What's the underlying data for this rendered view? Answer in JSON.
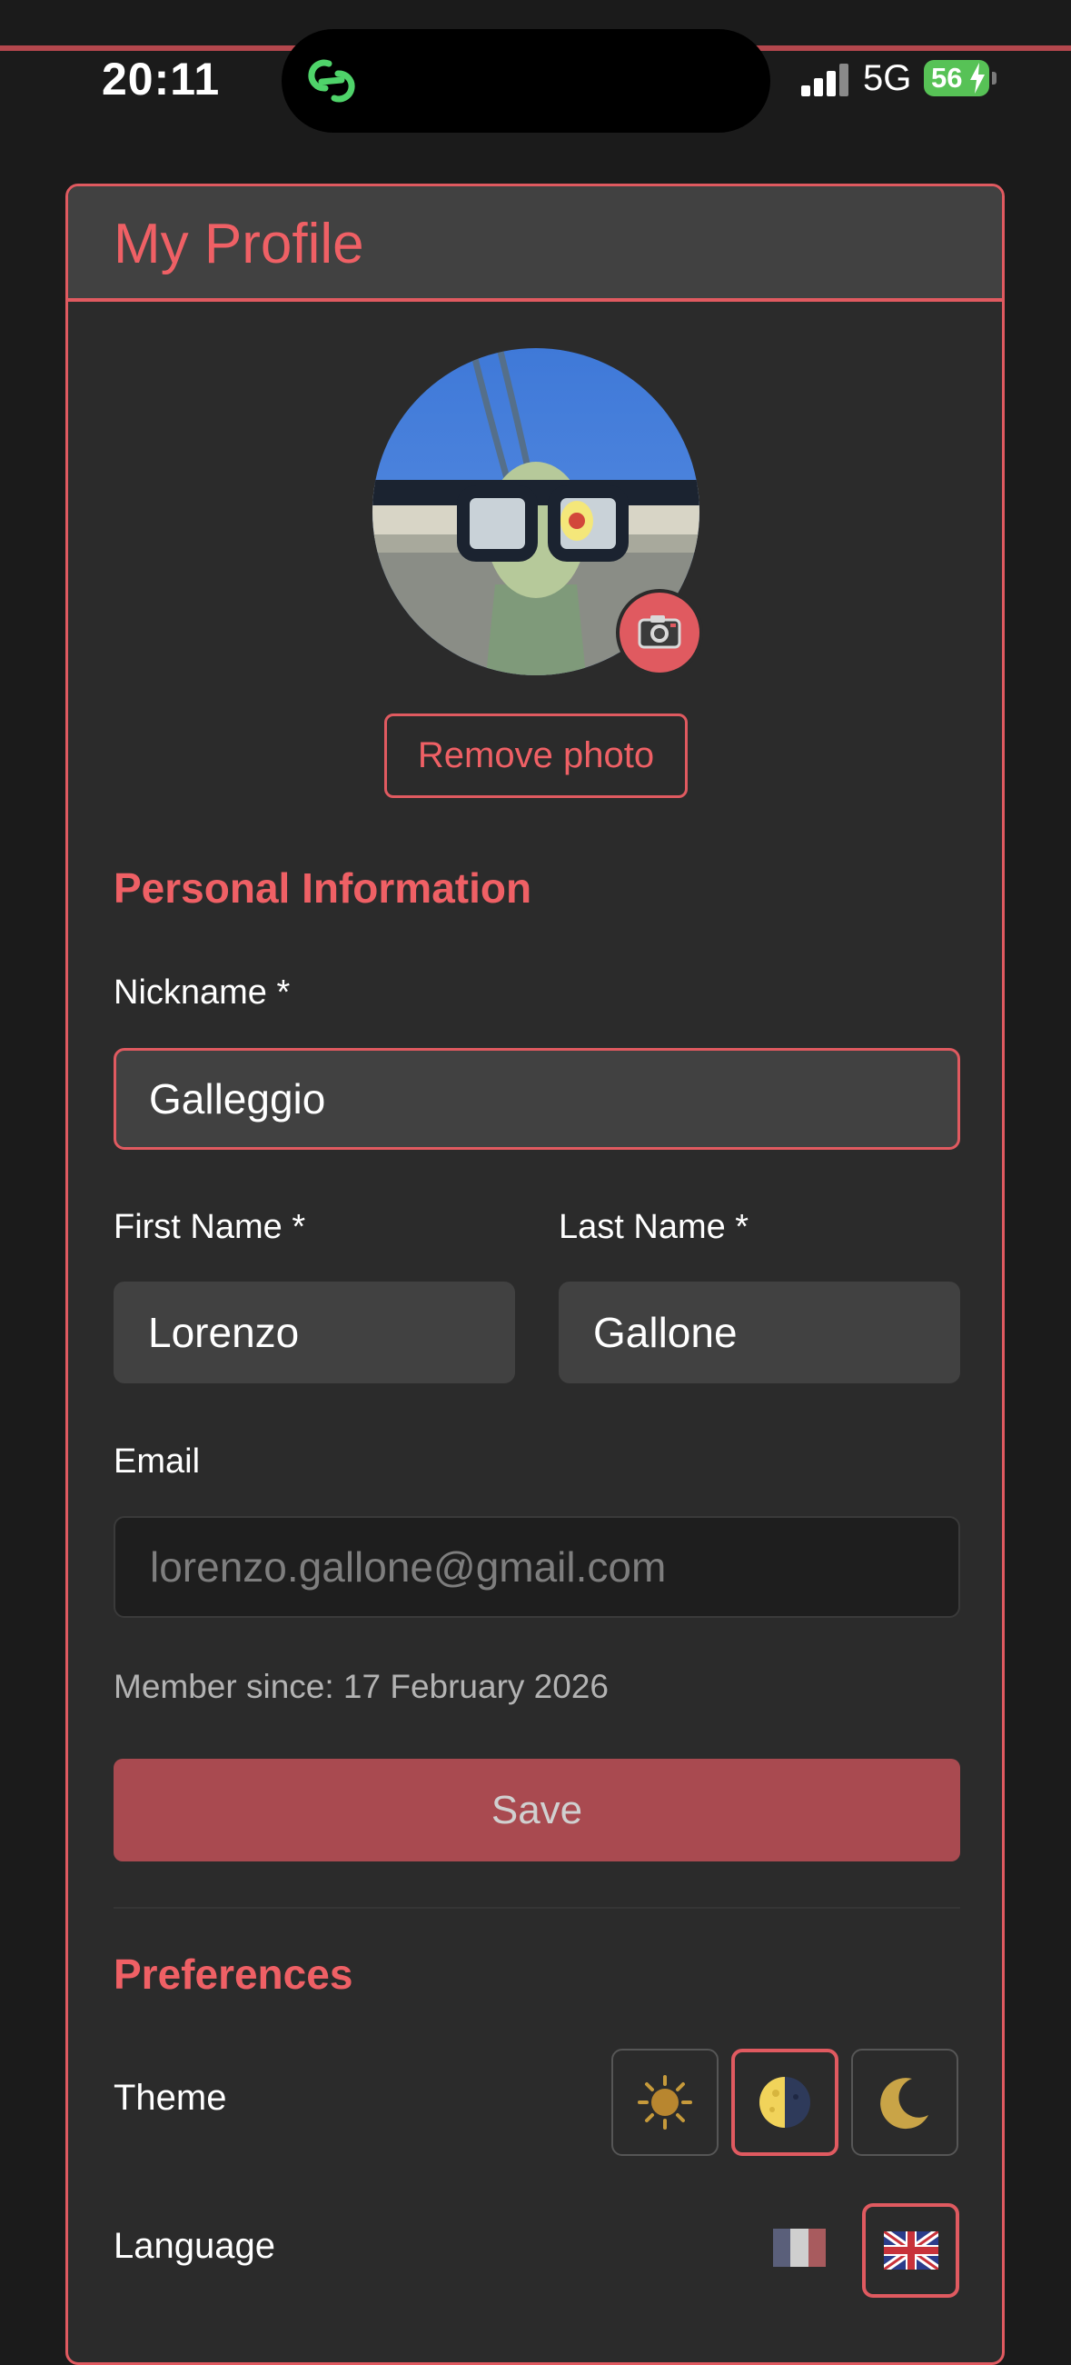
{
  "status_bar": {
    "time": "20:11",
    "network": "5G",
    "battery": "56"
  },
  "profile": {
    "title": "My Profile",
    "remove_photo": "Remove photo"
  },
  "personal": {
    "section_title": "Personal Information",
    "nickname_label": "Nickname *",
    "nickname_value": "Galleggio",
    "first_name_label": "First Name *",
    "first_name_value": "Lorenzo",
    "last_name_label": "Last Name *",
    "last_name_value": "Gallone",
    "email_label": "Email",
    "email_value": "lorenzo.gallone@gmail.com",
    "member_since": "Member since: 17 February 2026",
    "save_label": "Save"
  },
  "preferences": {
    "section_title": "Preferences",
    "theme_label": "Theme",
    "theme_options": [
      "sun-icon",
      "half-moon-icon",
      "crescent-moon-icon"
    ],
    "theme_selected": "half-moon-icon",
    "language_label": "Language",
    "language_options": [
      "flag-fr-icon",
      "flag-uk-icon"
    ],
    "language_selected": "flag-uk-icon"
  },
  "colors": {
    "accent": "#e05a60",
    "background": "#1b1b1b",
    "card": "#2b2b2b",
    "field": "#414141"
  }
}
